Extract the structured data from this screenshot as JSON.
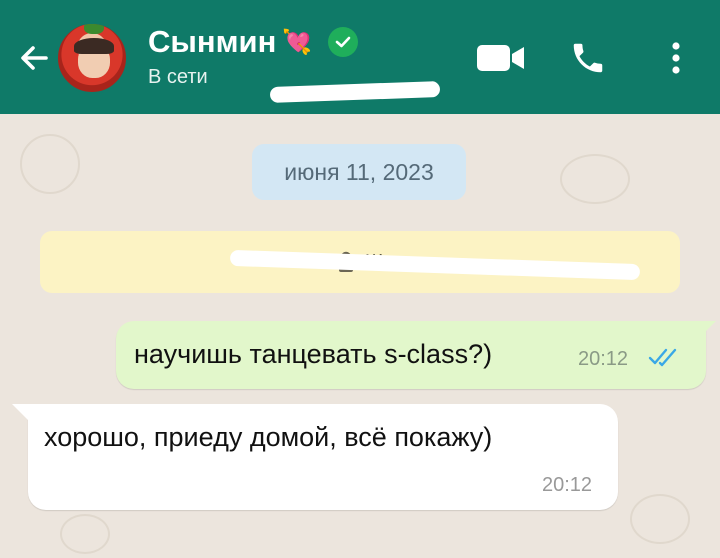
{
  "header": {
    "contact_name": "Сынмин",
    "name_emoji": "💘",
    "status": "В сети"
  },
  "chat": {
    "date_chip": "июня 11, 2023",
    "encryption_notice": "Ш",
    "messages": [
      {
        "direction": "outgoing",
        "text": "научишь танцевать s-class?)",
        "time": "20:12",
        "read": true
      },
      {
        "direction": "incoming",
        "text": "хорошо, приеду домой, всё покажу)",
        "time": "20:12"
      }
    ]
  },
  "colors": {
    "header_bg": "#0f7a68",
    "chat_bg": "#ece5dd",
    "outgoing_bubble": "#e2f7cb",
    "incoming_bubble": "#ffffff",
    "date_chip_bg": "#d3e7f4",
    "banner_bg": "#fcf3c4",
    "read_ticks": "#3aa8e6",
    "verified_badge": "#1fae5b"
  },
  "icons": [
    "back-arrow-icon",
    "verified-icon",
    "video-call-icon",
    "phone-call-icon",
    "more-options-icon",
    "lock-icon",
    "read-ticks-icon"
  ]
}
